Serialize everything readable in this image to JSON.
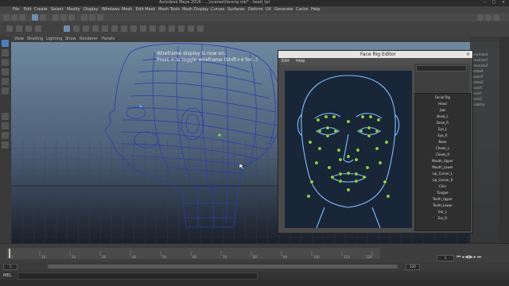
{
  "titlebar": {
    "title": "Autodesk Maya 2016 - ...\\scenes\\facerig.mb* - head_tpl",
    "controls": "– □ ×"
  },
  "menubar": {
    "items": [
      "File",
      "Edit",
      "Create",
      "Select",
      "Modify",
      "Display",
      "Windows",
      "Mesh",
      "Edit Mesh",
      "Mesh Tools",
      "Mesh Display",
      "Curves",
      "Surfaces",
      "Deform",
      "UV",
      "Generate",
      "Cache",
      "Help"
    ]
  },
  "viewport": {
    "menu": [
      "View",
      "Shading",
      "Lighting",
      "Show",
      "Renderer",
      "Panels"
    ],
    "hint_line1": "Wireframe display is now on.",
    "hint_line2": "Press 4 to toggle wireframe (Shift+4 for...)"
  },
  "facerig": {
    "title": "Face Rig Editor",
    "close": "×",
    "menu": [
      "Edit",
      "Help"
    ],
    "list_items": [
      "Facial Rig",
      "Head",
      "Jaw",
      "Brow_L",
      "Brow_R",
      "Eye_L",
      "Eye_R",
      "Nose",
      "Cheek_L",
      "Cheek_R",
      "Mouth_Upper",
      "Mouth_Lower",
      "Lip_Corner_L",
      "Lip_Corner_R",
      "Chin",
      "Tongue",
      "Teeth_Upper",
      "Teeth_Lower",
      "Ear_L",
      "Ear_R"
    ]
  },
  "channelbox": {
    "rows": [
      "translateX",
      "translateY",
      "translateZ",
      "rotateX",
      "rotateY",
      "rotateZ",
      "scaleX",
      "scaleY",
      "scaleZ",
      "visibility"
    ]
  },
  "timeline": {
    "ticks": [
      "1",
      "10",
      "20",
      "30",
      "40",
      "50",
      "60",
      "70",
      "80",
      "90",
      "100",
      "110",
      "120"
    ],
    "current_frame": "1",
    "start": "1",
    "end": "120"
  },
  "commandline": {
    "label": "MEL"
  }
}
